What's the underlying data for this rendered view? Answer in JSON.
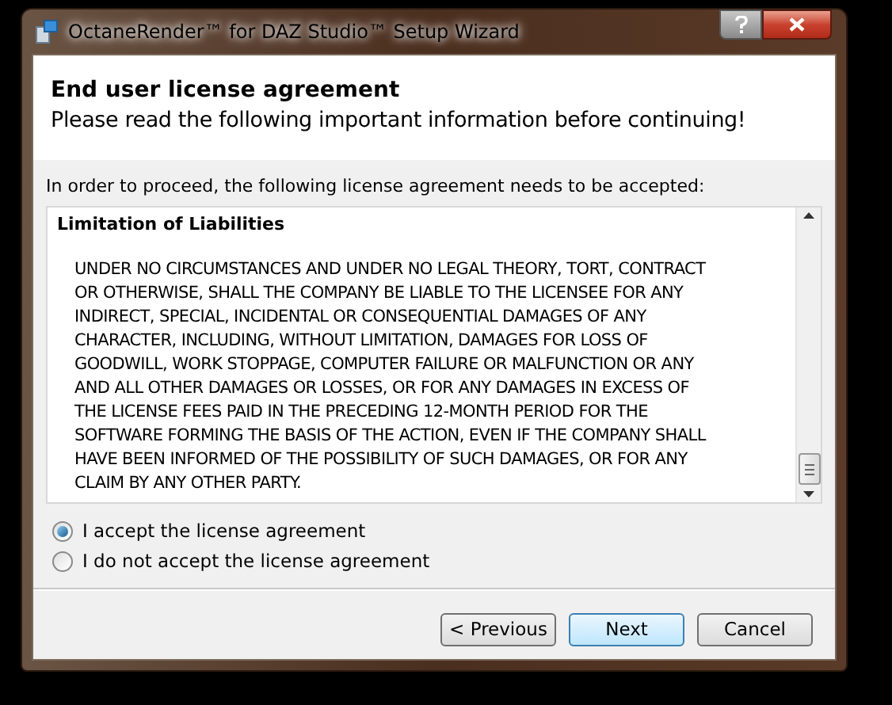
{
  "window": {
    "title": "OctaneRender™ for DAZ Studio™ Setup Wizard"
  },
  "header": {
    "title": "End user license agreement",
    "subtitle": "Please read the following important information before continuing!"
  },
  "intro": "In order to proceed, the following license agreement needs to be accepted:",
  "license": {
    "heading": "Limitation of Liabilities",
    "lines": [
      "UNDER NO CIRCUMSTANCES AND UNDER NO LEGAL THEORY, TORT, CONTRACT",
      "OR OTHERWISE, SHALL THE COMPANY BE LIABLE TO THE LICENSEE FOR ANY",
      "INDIRECT, SPECIAL, INCIDENTAL OR CONSEQUENTIAL DAMAGES OF ANY",
      "CHARACTER, INCLUDING, WITHOUT LIMITATION, DAMAGES FOR LOSS OF",
      "GOODWILL, WORK STOPPAGE, COMPUTER FAILURE OR MALFUNCTION OR ANY",
      "AND ALL OTHER DAMAGES OR LOSSES, OR FOR ANY DAMAGES IN EXCESS OF",
      "THE LICENSE FEES PAID IN THE PRECEDING 12-MONTH PERIOD FOR THE",
      "SOFTWARE FORMING THE BASIS OF THE ACTION, EVEN IF THE COMPANY SHALL",
      "HAVE BEEN INFORMED OF THE POSSIBILITY OF SUCH DAMAGES, OR FOR ANY",
      "CLAIM BY ANY OTHER PARTY."
    ]
  },
  "options": [
    {
      "label": "I accept the license agreement",
      "selected": true
    },
    {
      "label": "I do not accept the license agreement",
      "selected": false
    }
  ],
  "buttons": [
    {
      "label": "< Previous",
      "default": false
    },
    {
      "label": "Next",
      "default": true
    },
    {
      "label": "Cancel",
      "default": false
    }
  ]
}
